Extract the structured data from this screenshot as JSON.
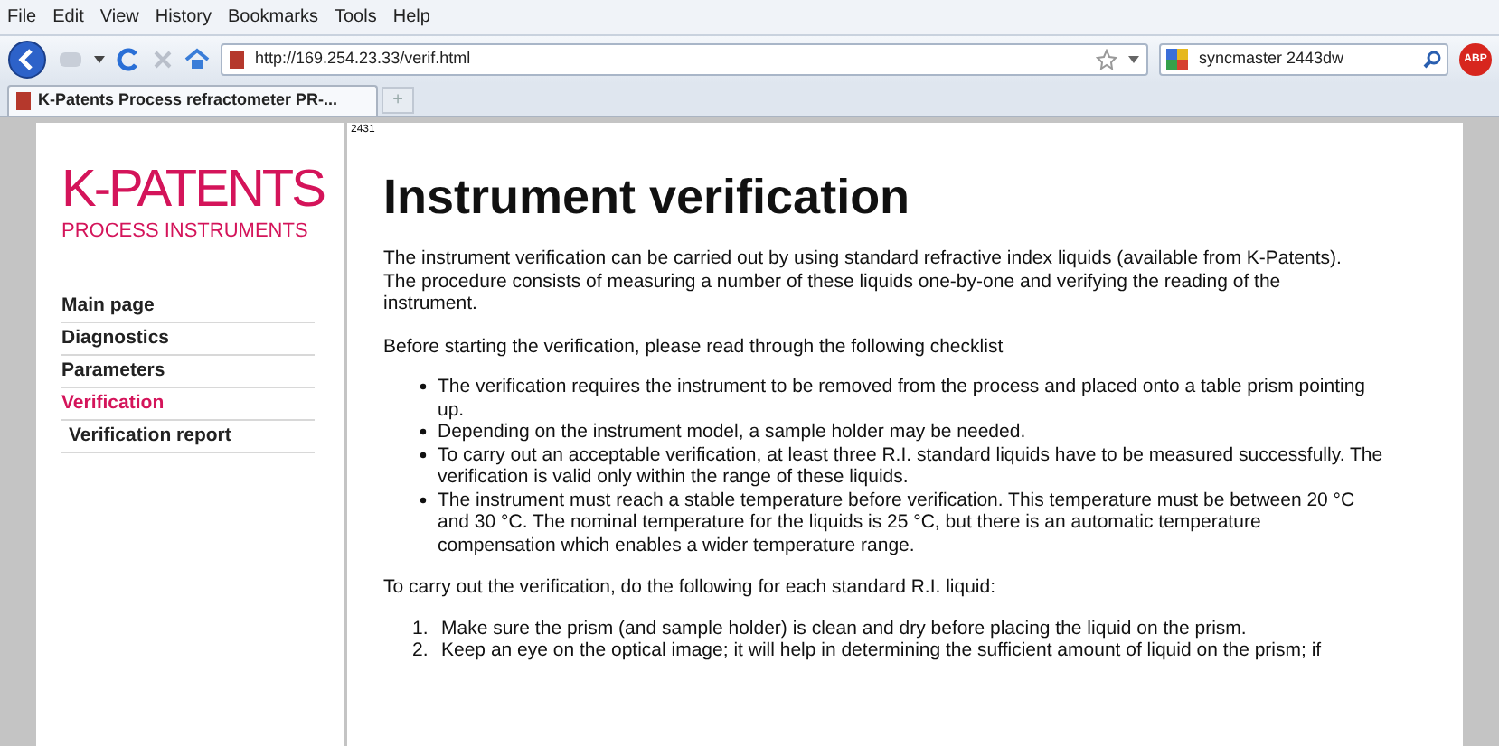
{
  "menu": [
    "File",
    "Edit",
    "View",
    "History",
    "Bookmarks",
    "Tools",
    "Help"
  ],
  "address": {
    "value": "http://169.254.23.33/verif.html"
  },
  "search": {
    "value": "syncmaster 2443dw"
  },
  "addon_badge": "ABP",
  "tabs": [
    {
      "label": "K-Patents Process refractometer PR-...",
      "selected": true
    }
  ],
  "new_tab": "+",
  "logo": {
    "name": "K-PATENTS",
    "tagline": "PROCESS INSTRUMENTS"
  },
  "sidebar": {
    "items": [
      {
        "label": "Main page",
        "selected": false
      },
      {
        "label": "Diagnostics",
        "selected": false
      },
      {
        "label": "Parameters",
        "selected": false
      },
      {
        "label": "Verification",
        "selected": true,
        "children": [
          {
            "label": "Verification report",
            "selected": false
          }
        ]
      }
    ]
  },
  "page": {
    "code": "2431",
    "title": "Instrument verification",
    "intro": "The instrument verification can be carried out by using standard refractive index liquids (available from K-Patents). The procedure consists of measuring a number of these liquids one-by-one and verifying the reading of the instrument.",
    "checklist_intro": "Before starting the verification, please read through the following checklist",
    "checklist": [
      "The verification requires the instrument to be removed from the process and placed onto a table prism pointing up.",
      "Depending on the instrument model, a sample holder may be needed.",
      "To carry out an acceptable verification, at least three R.I. standard liquids have to be measured successfully. The verification is valid only within the range of these liquids.",
      "The instrument must reach a stable temperature before verification. This temperature must be between 20 °C and 30 °C. The nominal temperature for the liquids is 25 °C, but there is an automatic temperature compensation which enables a wider temperature range."
    ],
    "steps_intro": "To carry out the verification, do the following for each standard R.I. liquid:",
    "steps": [
      {
        "number": "1.",
        "text": "Make sure the prism (and sample holder) is clean and dry before placing the liquid on the prism."
      },
      {
        "number": "2.",
        "text": "Keep an eye on the optical image; it will help in determining the sufficient amount of liquid on the prism; if"
      }
    ]
  }
}
